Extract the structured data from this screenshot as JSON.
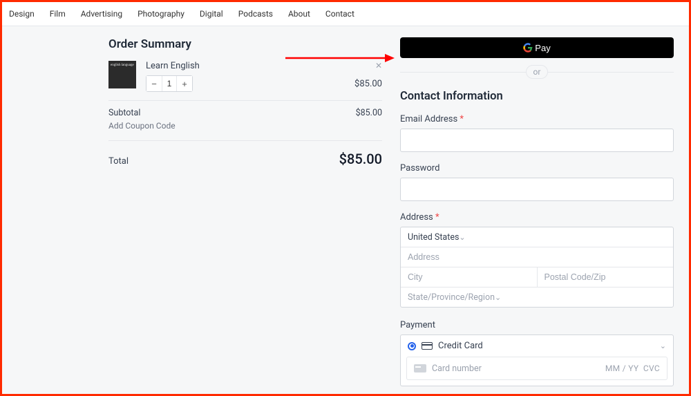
{
  "nav": {
    "items": [
      "Design",
      "Film",
      "Advertising",
      "Photography",
      "Digital",
      "Podcasts",
      "About",
      "Contact"
    ]
  },
  "order_summary": {
    "title": "Order Summary",
    "items": [
      {
        "name": "Learn English",
        "qty": "1",
        "price": "$85.00"
      }
    ],
    "subtotal_label": "Subtotal",
    "subtotal": "$85.00",
    "coupon_link": "Add Coupon Code",
    "total_label": "Total",
    "total": "$85.00"
  },
  "checkout": {
    "gpay_label": "Pay",
    "or_label": "or",
    "contact_title": "Contact Information",
    "email_label": "Email Address",
    "password_label": "Password",
    "address_label": "Address",
    "country_selected": "United States",
    "address_placeholder": "Address",
    "city_placeholder": "City",
    "postal_placeholder": "Postal Code/Zip",
    "state_placeholder": "State/Province/Region",
    "payment_label": "Payment",
    "credit_card_label": "Credit Card",
    "card_number_placeholder": "Card number",
    "expiry_placeholder": "MM / YY",
    "cvc_placeholder": "CVC"
  }
}
